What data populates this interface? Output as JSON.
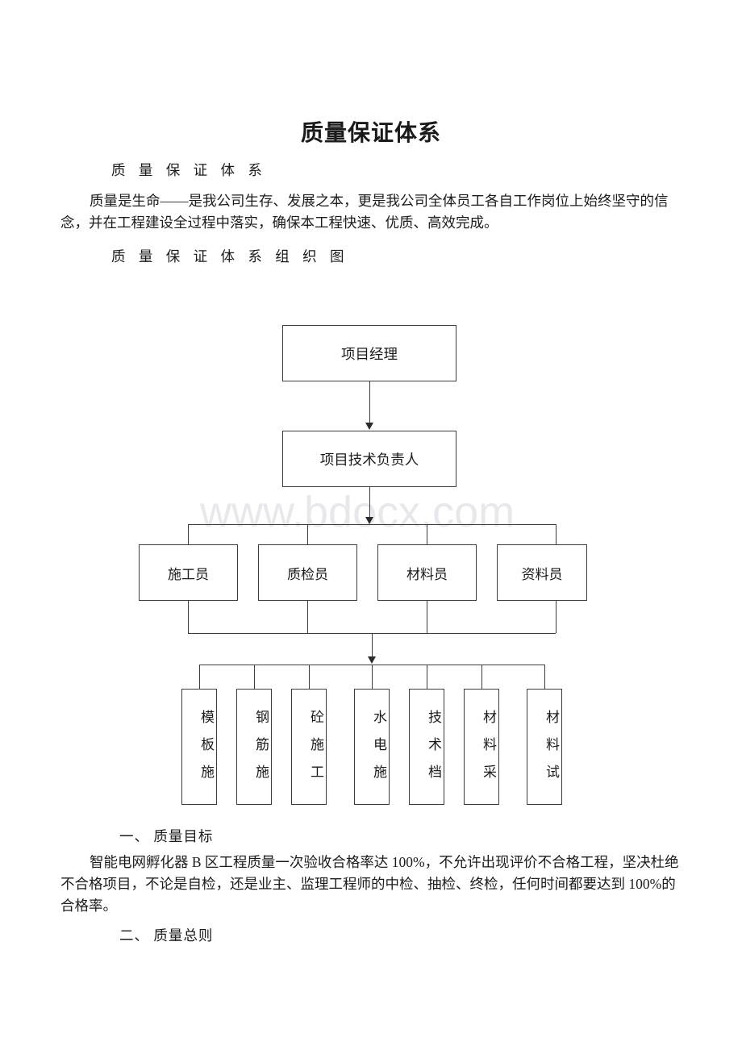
{
  "document": {
    "title": "质量保证体系",
    "sub_heading_1": "质 量 保 证 体 系",
    "lead_paragraph": "质量是生命——是我公司生存、发展之本，更是我公司全体员工各自工作岗位上始终坚守的信念，并在工程建设全过程中落实，确保本工程快速、优质、高效完成。",
    "sub_heading_2": "质 量 保 证 体 系 组 织 图",
    "section_heading_1": "一、 质量目标",
    "goal_paragraph": "智能电网孵化器 B 区工程质量一次验收合格率达 100%，不允许出现评价不合格工程，坚决杜绝不合格项目，不论是自检，还是业主、监理工程师的中检、抽检、终检，任何时间都要达到 100%的合格率。",
    "section_heading_2": "二、 质量总则"
  },
  "watermark": {
    "text": "www.bdocx.com",
    "color": "#e8e8ec"
  },
  "org_chart": {
    "level_1": [
      {
        "label": "项目经理"
      }
    ],
    "level_2": [
      {
        "label": "项目技术负责人"
      }
    ],
    "level_3": [
      {
        "label": "施工员"
      },
      {
        "label": "质检员"
      },
      {
        "label": "材料员"
      },
      {
        "label": "资料员"
      }
    ],
    "level_4": [
      {
        "label": "模板施"
      },
      {
        "label": "钢筋施"
      },
      {
        "label": "砼施工"
      },
      {
        "label": "水电施"
      },
      {
        "label": "技术档"
      },
      {
        "label": "材料采"
      },
      {
        "label": "材料试"
      }
    ],
    "line_color": "#3c3c3c"
  }
}
